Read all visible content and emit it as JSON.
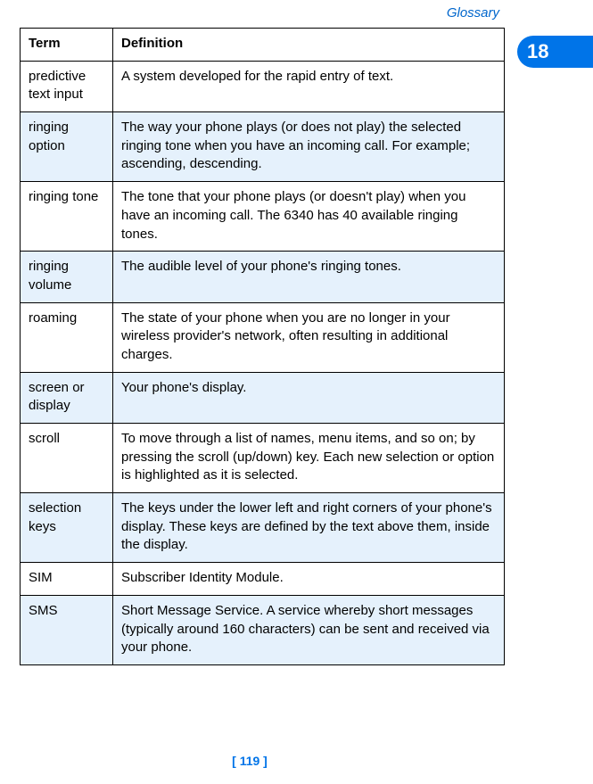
{
  "section": "Glossary",
  "chapter_tab": "18",
  "table": {
    "headers": {
      "term": "Term",
      "definition": "Definition"
    },
    "rows": [
      {
        "term": "predictive text input",
        "definition": "A system developed for the rapid entry of text.",
        "alt": false
      },
      {
        "term": "ringing option",
        "definition": "The way your phone plays (or does not play) the selected ringing tone when you have an incoming call. For example; ascending, descending.",
        "alt": true
      },
      {
        "term": "ringing tone",
        "definition": "The tone that your phone plays (or doesn't play) when you have an incoming call. The 6340 has 40 available ringing tones.",
        "alt": false
      },
      {
        "term": "ringing volume",
        "definition": "The audible level of your phone's ringing tones.",
        "alt": true
      },
      {
        "term": "roaming",
        "definition": "The state of your phone when you are no longer in your wireless provider's network, often resulting in additional charges.",
        "alt": false
      },
      {
        "term": "screen or display",
        "definition": "Your phone's display.",
        "alt": true
      },
      {
        "term": "scroll",
        "definition": "To move through a list of names, menu items, and so on; by pressing the scroll (up/down) key. Each new selection or option is highlighted as it is selected.",
        "alt": false
      },
      {
        "term": "selection keys",
        "definition": "The keys under the lower left and right corners of your phone's display. These keys are defined by the text above them, inside the display.",
        "alt": true
      },
      {
        "term": "SIM",
        "definition": "Subscriber Identity Module.",
        "alt": false
      },
      {
        "term": "SMS",
        "definition": "Short Message Service. A service whereby short messages (typically around 160 characters) can be sent and received via your phone.",
        "alt": true
      }
    ]
  },
  "page_number": "[ 119 ]"
}
